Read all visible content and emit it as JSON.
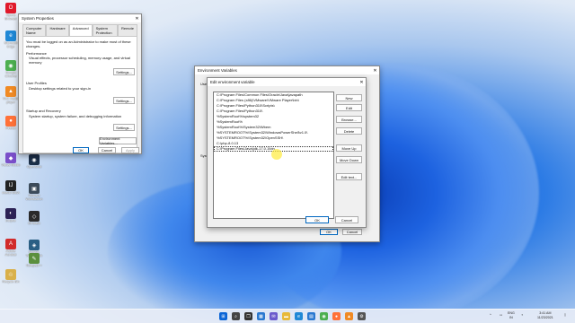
{
  "desktop": {
    "icons_left": [
      {
        "label": "Opera Browser",
        "color": "#e0192b",
        "glyph": "O"
      },
      {
        "label": "Microsoft Edge",
        "color": "#1f88d6",
        "glyph": "e"
      },
      {
        "label": "Google Chrome",
        "color": "#4caf50",
        "glyph": "◉"
      },
      {
        "label": "VLC media player",
        "color": "#f08a24",
        "glyph": "▲"
      },
      {
        "label": "Firefox",
        "color": "#ff7139",
        "glyph": "●"
      },
      {
        "label": "Visual Studio",
        "color": "#7a4fc9",
        "glyph": "◆"
      },
      {
        "label": "IntelliJ IDEA",
        "color": "#222",
        "glyph": "IJ"
      },
      {
        "label": "Eclipse",
        "color": "#2c2255",
        "glyph": "◐"
      },
      {
        "label": "Adobe Acrobat",
        "color": "#d12b2b",
        "glyph": "A"
      },
      {
        "label": "Recycle Bin",
        "color": "#d9b04a",
        "glyph": "♲"
      }
    ],
    "icons_right": [
      {
        "label": "OpenShot",
        "color": "#1b2e47",
        "glyph": "◉"
      },
      {
        "label": "VMware Workstation",
        "color": "#3c4b5a",
        "glyph": "▣"
      },
      {
        "label": "Git Bash",
        "color": "#2a2a2a",
        "glyph": "◇"
      },
      {
        "label": "MySQL Workbench",
        "color": "#2a5f84",
        "glyph": "◈"
      },
      {
        "label": "Notepad++",
        "color": "#5a8f3d",
        "glyph": "✎"
      }
    ]
  },
  "sysprops": {
    "title": "System Properties",
    "tabs": [
      "Computer Name",
      "Hardware",
      "Advanced",
      "System Protection",
      "Remote"
    ],
    "active_tab": "Advanced",
    "admin_note": "You must be logged on as an Administrator to make most of these changes.",
    "perf_title": "Performance",
    "perf_text": "Visual effects, processor scheduling, memory usage, and virtual memory",
    "profiles_title": "User Profiles",
    "profiles_text": "Desktop settings related to your sign-in",
    "startup_title": "Startup and Recovery",
    "startup_text": "System startup, system failure, and debugging information",
    "settings_label": "Settings...",
    "env_label": "Environment Variables...",
    "ok": "OK",
    "cancel": "Cancel",
    "apply": "Apply"
  },
  "envvars": {
    "title": "Environment Variables",
    "user_label": "User",
    "system_label": "Syst",
    "ok": "OK",
    "cancel": "Cancel"
  },
  "editenv": {
    "title": "Edit environment variable",
    "paths": [
      "C:\\Program Files\\Common Files\\Oracle\\Java\\javapath",
      "C:\\Program Files (x86)\\VMware\\VMware Player\\bin\\",
      "C:\\Program Files\\Python310\\Scripts\\",
      "C:\\Program Files\\Python310\\",
      "%SystemRoot%\\system32",
      "%SystemRoot%",
      "%SystemRoot%\\System32\\Wbem",
      "%SYSTEMROOT%\\System32\\WindowsPowerShell\\v1.0\\",
      "%SYSTEMROOT%\\System32\\OpenSSH\\",
      "C:\\php-8.0.13",
      "C:\\Program Files\\Java\\jdk-17.0.1\\bin"
    ],
    "selected_index": 10,
    "buttons": [
      "New",
      "Edit",
      "Browse...",
      "Delete",
      "Move Up",
      "Move Down",
      "Edit text..."
    ],
    "ok": "OK",
    "cancel": "Cancel"
  },
  "taskbar": {
    "icons": [
      {
        "name": "start-icon",
        "glyph": "⊞",
        "color": "#0a64d6"
      },
      {
        "name": "search-icon",
        "glyph": "⌕",
        "color": "#444"
      },
      {
        "name": "taskview-icon",
        "glyph": "❐",
        "color": "#333"
      },
      {
        "name": "widgets-icon",
        "glyph": "▦",
        "color": "#2a78d0"
      },
      {
        "name": "chat-icon",
        "glyph": "✉",
        "color": "#6a5acd"
      },
      {
        "name": "explorer-icon",
        "glyph": "▬",
        "color": "#e7b93a"
      },
      {
        "name": "edge-icon",
        "glyph": "e",
        "color": "#1f88d6"
      },
      {
        "name": "store-icon",
        "glyph": "▤",
        "color": "#2a78d0"
      },
      {
        "name": "chrome-icon",
        "glyph": "◉",
        "color": "#4caf50"
      },
      {
        "name": "firefox-icon",
        "glyph": "●",
        "color": "#ff7139"
      },
      {
        "name": "vlc-icon",
        "glyph": "▲",
        "color": "#f08a24"
      },
      {
        "name": "settings-icon",
        "glyph": "⚙",
        "color": "#555"
      }
    ],
    "lang_top": "ENG",
    "lang_bottom": "IN",
    "time": "3:41 AM",
    "date": "11/23/2021"
  }
}
